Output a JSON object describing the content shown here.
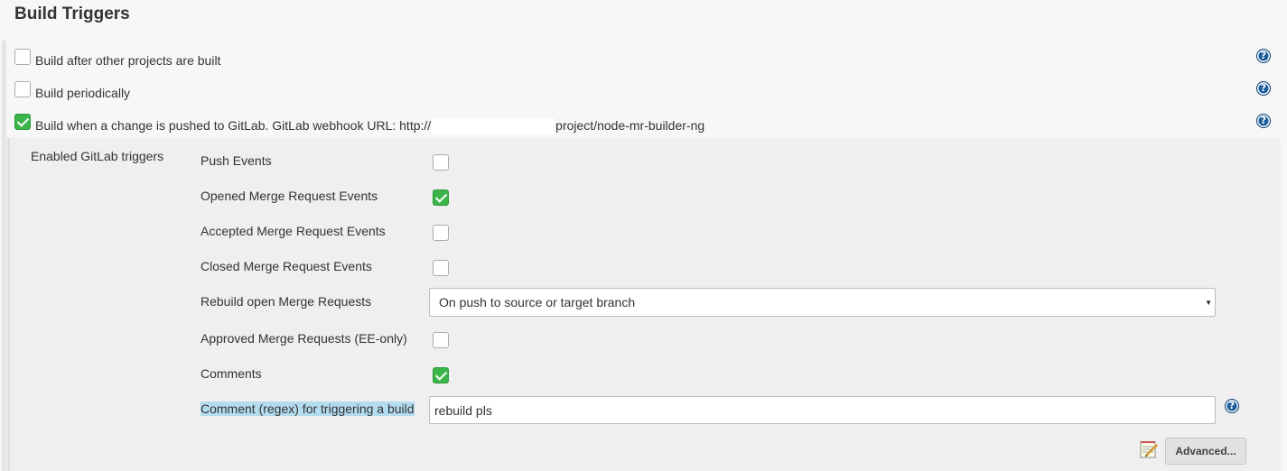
{
  "section": {
    "title": "Build Triggers"
  },
  "triggers": [
    {
      "label": "Build after other projects are built",
      "checked": false
    },
    {
      "label": "Build periodically",
      "checked": false
    },
    {
      "label_prefix": "Build when a change is pushed to GitLab. GitLab webhook URL: http://",
      "label_suffix": "project/node-mr-builder-ng",
      "checked": true
    }
  ],
  "gitlab": {
    "group_label": "Enabled GitLab triggers",
    "options": [
      {
        "label": "Push Events",
        "checked": false
      },
      {
        "label": "Opened Merge Request Events",
        "checked": true
      },
      {
        "label": "Accepted Merge Request Events",
        "checked": false
      },
      {
        "label": "Closed Merge Request Events",
        "checked": false
      }
    ],
    "rebuild": {
      "label": "Rebuild open Merge Requests",
      "value": "On push to source or target branch"
    },
    "approved": {
      "label": "Approved Merge Requests (EE-only)",
      "checked": false
    },
    "comments": {
      "label": "Comments",
      "checked": true
    },
    "comment_regex": {
      "label": "Comment (regex) for triggering a build",
      "value": "rebuild pls"
    },
    "advanced_label": "Advanced..."
  },
  "icons": {
    "help": "help-icon",
    "notepad": "notepad-icon"
  },
  "colors": {
    "check_green": "#3bb54a",
    "help_blue": "#1a5c9e",
    "highlight": "#b4dcef"
  }
}
